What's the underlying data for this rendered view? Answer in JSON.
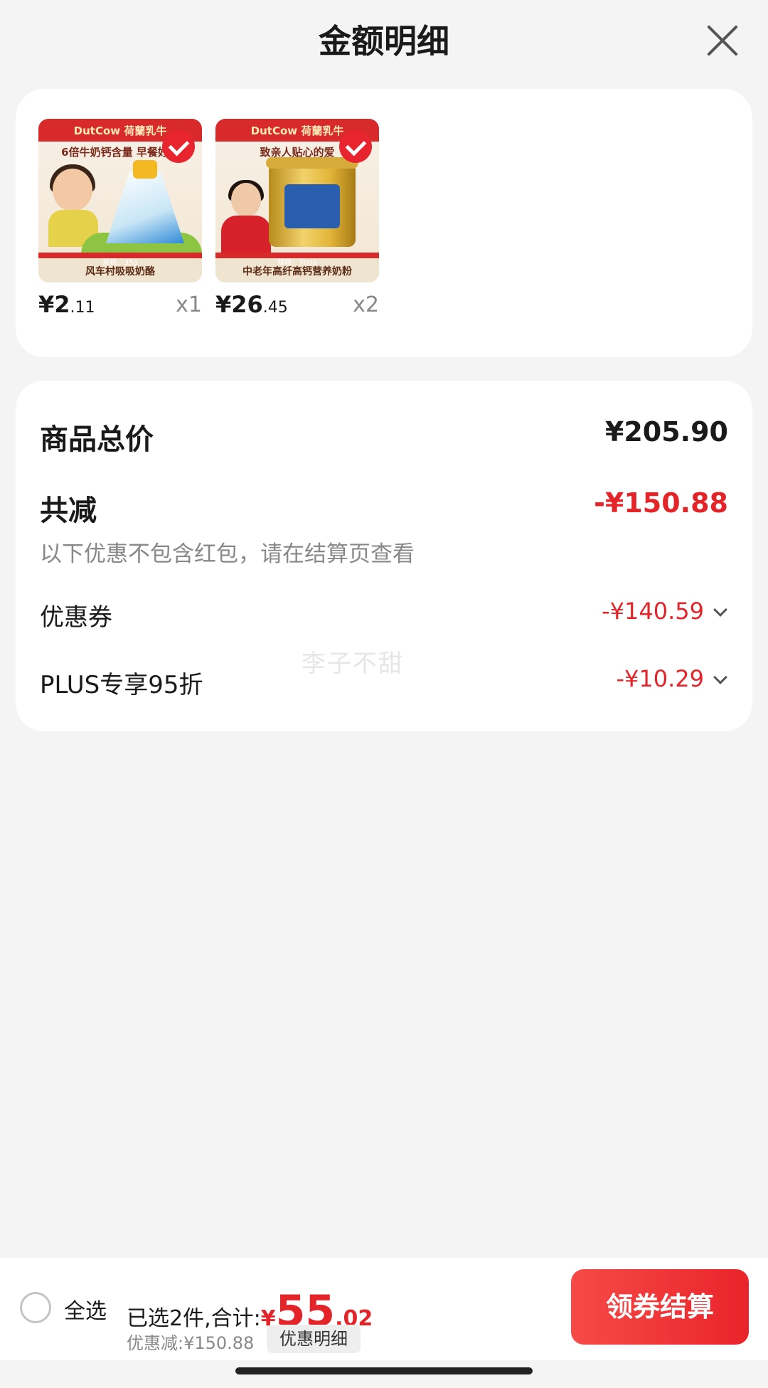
{
  "header": {
    "title": "金额明细",
    "close_icon": "close-icon"
  },
  "products": [
    {
      "brand": "DutCow 荷蘭乳牛",
      "slogan": "6倍牛奶钙含量 早餐好伴",
      "spec": "规格：35g",
      "caption": "风车村吸吸奶酪",
      "price_currency": "¥",
      "price_int": "2",
      "price_dec": ".11",
      "qty": "x1",
      "selected": true
    },
    {
      "brand": "DutCow 荷蘭乳牛",
      "slogan": "致亲人贴心的爱",
      "spec": "规格：700g",
      "caption": "中老年高纤高钙营养奶粉",
      "price_currency": "¥",
      "price_int": "26",
      "price_dec": ".45",
      "qty": "x2",
      "selected": true
    }
  ],
  "summary": {
    "total_label": "商品总价",
    "total_value": "¥205.90",
    "reduce_label": "共减",
    "reduce_value": "-¥150.88",
    "note": "以下优惠不包含红包，请在结算页查看",
    "coupon_label": "优惠券",
    "coupon_value": "-¥140.59",
    "plus_label": "PLUS专享95折",
    "plus_value": "-¥10.29",
    "watermark": "李子不甜"
  },
  "bottom": {
    "select_all": "全选",
    "selected_prefix": "已选2件,合计:",
    "sum_currency": "¥",
    "sum_int": "55",
    "sum_dec": ".02",
    "discount_text": "优惠减:¥150.88",
    "detail_button": "优惠明细",
    "checkout_button": "领券结算"
  },
  "colors": {
    "accent_red": "#e3252a",
    "background": "#f4f4f4"
  }
}
